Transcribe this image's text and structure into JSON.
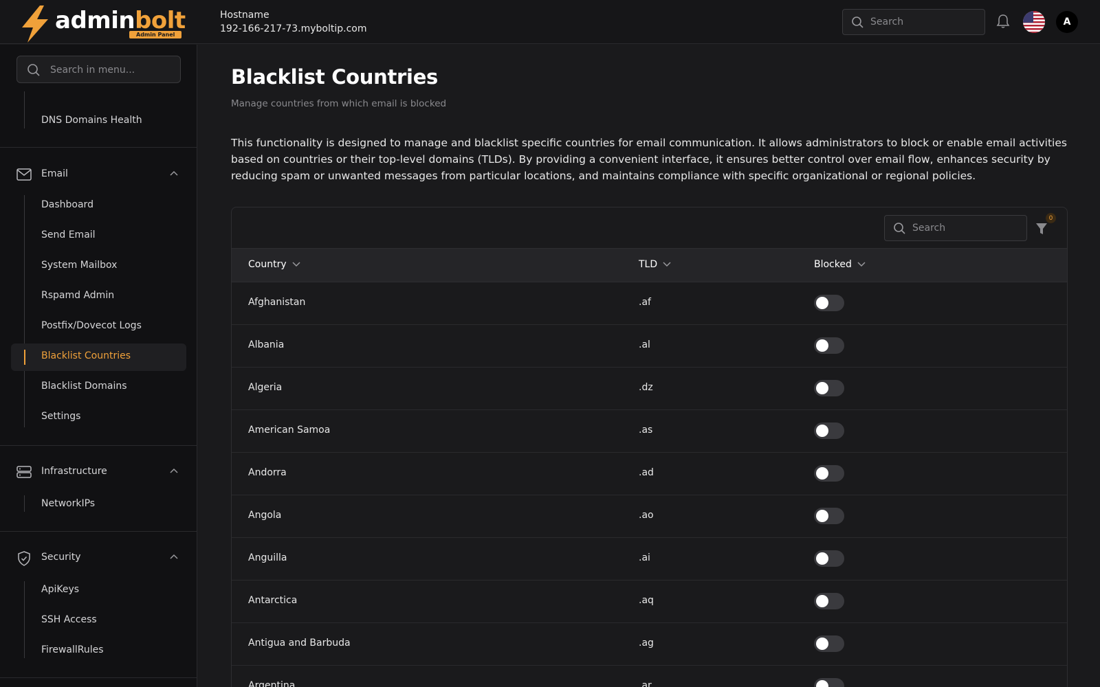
{
  "header": {
    "logo_primary": "admin",
    "logo_accent": "bolt",
    "logo_badge": "Admin Panel",
    "hostname_label": "Hostname",
    "hostname_value": "192-166-217-73.myboltip.com",
    "search_placeholder": "Search",
    "avatar_initial": "A",
    "icons": [
      "search-icon",
      "bell-icon",
      "us-flag-icon"
    ]
  },
  "sidebar": {
    "search_placeholder": "Search in menu...",
    "top_items": [
      {
        "label": "DNS Domains Health"
      }
    ],
    "groups": [
      {
        "label": "Email",
        "icon": "mail-icon",
        "expanded": true,
        "items": [
          {
            "label": "Dashboard"
          },
          {
            "label": "Send Email"
          },
          {
            "label": "System Mailbox"
          },
          {
            "label": "Rspamd Admin"
          },
          {
            "label": "Postfix/Dovecot Logs"
          },
          {
            "label": "Blacklist Countries",
            "active": true
          },
          {
            "label": "Blacklist Domains"
          },
          {
            "label": "Settings"
          }
        ]
      },
      {
        "label": "Infrastructure",
        "icon": "server-icon",
        "expanded": true,
        "items": [
          {
            "label": "NetworkIPs"
          }
        ]
      },
      {
        "label": "Security",
        "icon": "shield-icon",
        "expanded": true,
        "items": [
          {
            "label": "ApiKeys"
          },
          {
            "label": "SSH Access"
          },
          {
            "label": "FirewallRules"
          }
        ]
      }
    ]
  },
  "main": {
    "title": "Blacklist Countries",
    "subtitle": "Manage countries from which email is blocked",
    "description": "This functionality is designed to manage and blacklist specific countries for email communication. It allows administrators to block or enable email activities based on countries or their top-level domains (TLDs). By providing a convenient interface, it ensures better control over email flow, enhances security by reducing spam or unwanted messages from particular locations, and maintains compliance with specific organizational or regional policies.",
    "table": {
      "search_placeholder": "Search",
      "filter_count": "0",
      "columns": [
        "Country",
        "TLD",
        "Blocked"
      ],
      "rows": [
        {
          "country": "Afghanistan",
          "tld": ".af",
          "blocked": false
        },
        {
          "country": "Albania",
          "tld": ".al",
          "blocked": false
        },
        {
          "country": "Algeria",
          "tld": ".dz",
          "blocked": false
        },
        {
          "country": "American Samoa",
          "tld": ".as",
          "blocked": false
        },
        {
          "country": "Andorra",
          "tld": ".ad",
          "blocked": false
        },
        {
          "country": "Angola",
          "tld": ".ao",
          "blocked": false
        },
        {
          "country": "Anguilla",
          "tld": ".ai",
          "blocked": false
        },
        {
          "country": "Antarctica",
          "tld": ".aq",
          "blocked": false
        },
        {
          "country": "Antigua and Barbuda",
          "tld": ".ag",
          "blocked": false
        },
        {
          "country": "Argentina",
          "tld": ".ar",
          "blocked": false
        }
      ]
    }
  },
  "colors": {
    "accent": "#f0a13a",
    "background": "#1a1a1c",
    "sidebar": "#111113",
    "toggle_off": "#3a3a3e"
  }
}
